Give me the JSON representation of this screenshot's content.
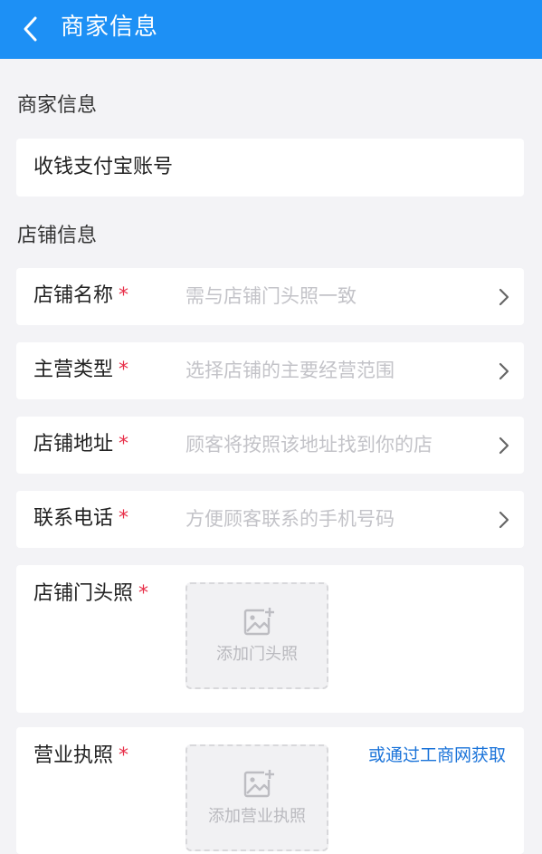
{
  "header": {
    "title": "商家信息",
    "back_icon": "chevron-left-icon"
  },
  "merchant_section": {
    "label": "商家信息",
    "item": "收钱支付宝账号"
  },
  "store_section": {
    "label": "店铺信息",
    "rows": [
      {
        "label": "店铺名称",
        "required": "*",
        "placeholder": "需与店铺门头照一致"
      },
      {
        "label": "主营类型",
        "required": "*",
        "placeholder": "选择店铺的主要经营范围"
      },
      {
        "label": "店铺地址",
        "required": "*",
        "placeholder": "顾客将按照该地址找到你的店"
      },
      {
        "label": "联系电话",
        "required": "*",
        "placeholder": "方便顾客联系的手机号码"
      }
    ],
    "storefront_photo": {
      "label": "店铺门头照",
      "required": "*",
      "upload_text": "添加门头照"
    },
    "business_license": {
      "label": "营业执照",
      "required": "*",
      "upload_text": "添加营业执照",
      "link": "或通过工商网获取"
    }
  },
  "colors": {
    "header_bg": "#1d90f5",
    "required": "#e8304a",
    "link": "#1a73d9",
    "background": "#f3f3f6"
  }
}
